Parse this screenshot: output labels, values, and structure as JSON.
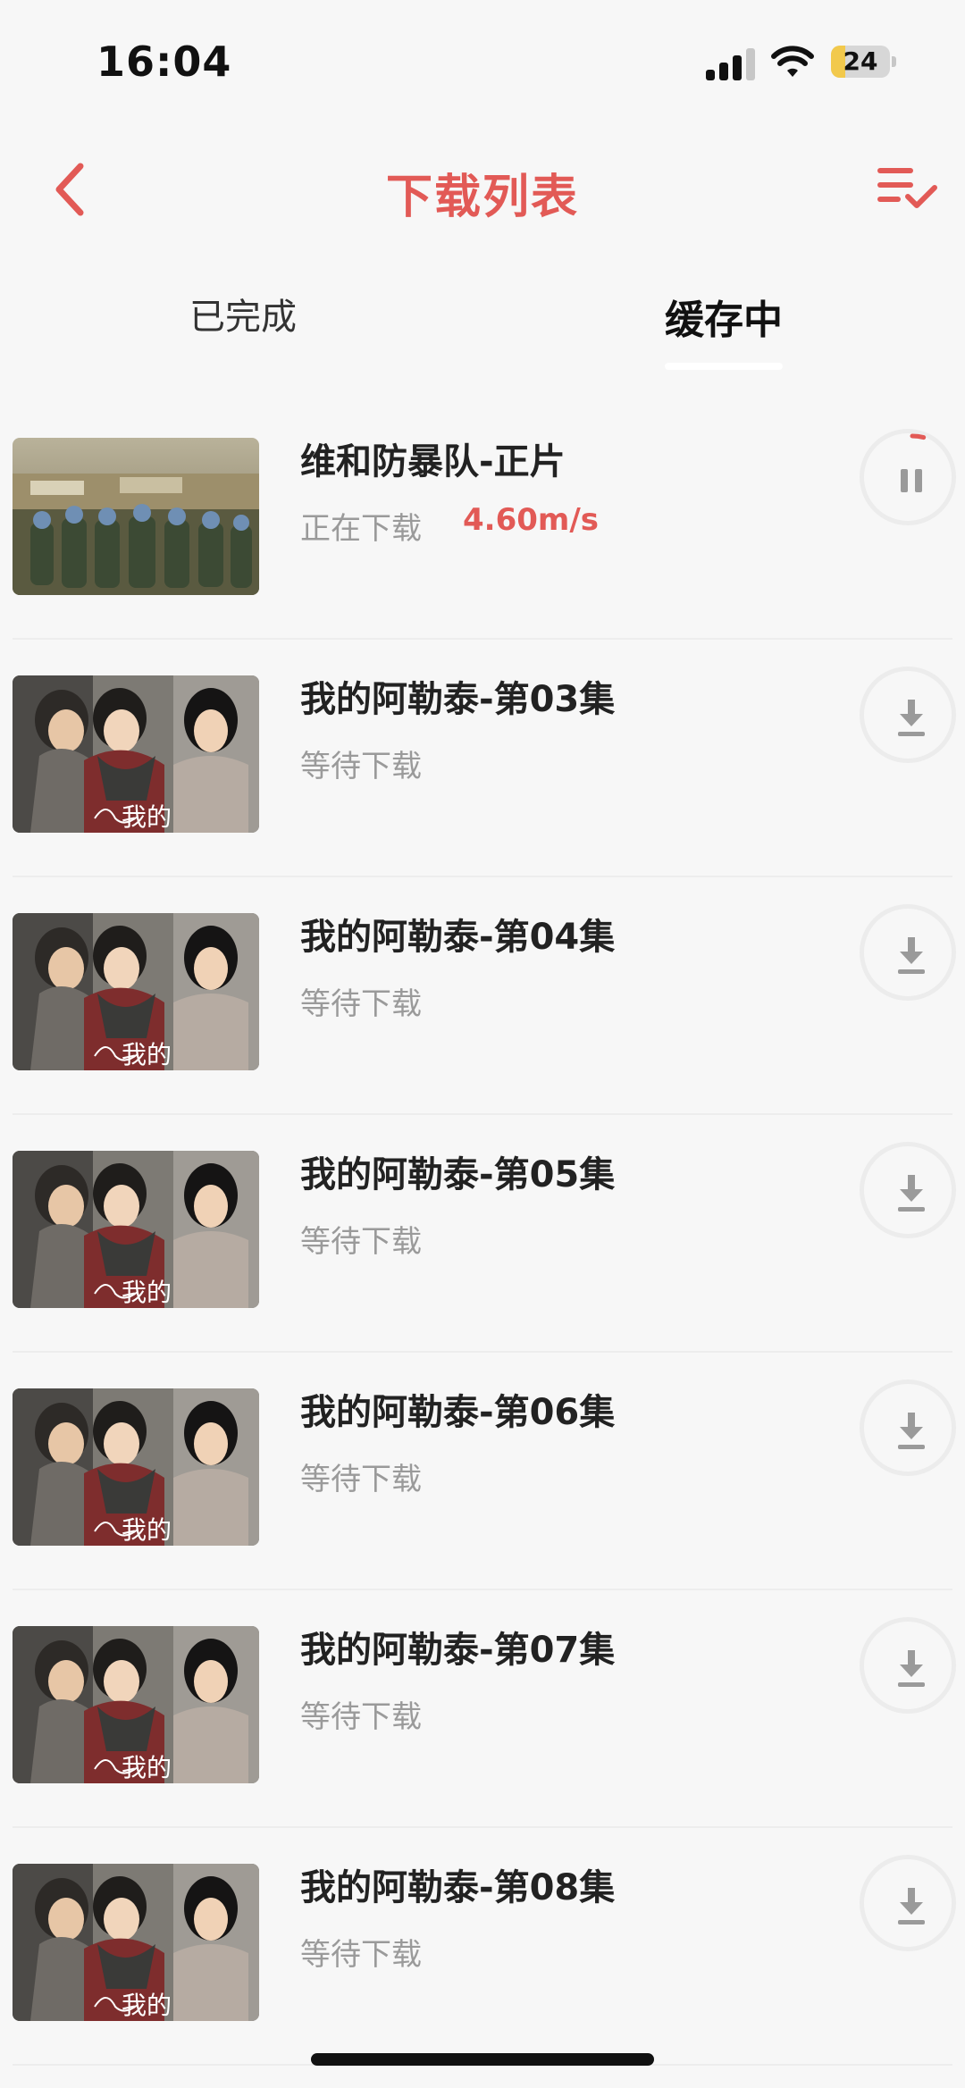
{
  "status_bar": {
    "time": "16:04",
    "battery": "24",
    "battery_level": 0.24
  },
  "nav": {
    "title": "下载列表",
    "back_icon": "chevron-left-icon",
    "manage_icon": "list-check-icon"
  },
  "tabs": [
    {
      "label": "已完成",
      "active": false
    },
    {
      "label": "缓存中",
      "active": true
    }
  ],
  "items": [
    {
      "title": "维和防暴队-正片",
      "status": "正在下载",
      "speed": "4.60m/s",
      "action": "pause-icon",
      "progress": 0.04,
      "thumb": "peacekeepers-poster"
    },
    {
      "title": "我的阿勒泰-第03集",
      "status": "等待下载",
      "speed": "",
      "action": "download-icon",
      "thumb": "altay-poster",
      "thumb_caption": "我的"
    },
    {
      "title": "我的阿勒泰-第04集",
      "status": "等待下载",
      "speed": "",
      "action": "download-icon",
      "thumb": "altay-poster",
      "thumb_caption": "我的"
    },
    {
      "title": "我的阿勒泰-第05集",
      "status": "等待下载",
      "speed": "",
      "action": "download-icon",
      "thumb": "altay-poster",
      "thumb_caption": "我的"
    },
    {
      "title": "我的阿勒泰-第06集",
      "status": "等待下载",
      "speed": "",
      "action": "download-icon",
      "thumb": "altay-poster",
      "thumb_caption": "我的"
    },
    {
      "title": "我的阿勒泰-第07集",
      "status": "等待下载",
      "speed": "",
      "action": "download-icon",
      "thumb": "altay-poster",
      "thumb_caption": "我的"
    },
    {
      "title": "我的阿勒泰-第08集",
      "status": "等待下载",
      "speed": "",
      "action": "download-icon",
      "thumb": "altay-poster",
      "thumb_caption": "我的"
    }
  ],
  "colors": {
    "accent": "#e25a56",
    "muted": "#9a9a9a",
    "background": "#f7f7f7"
  }
}
